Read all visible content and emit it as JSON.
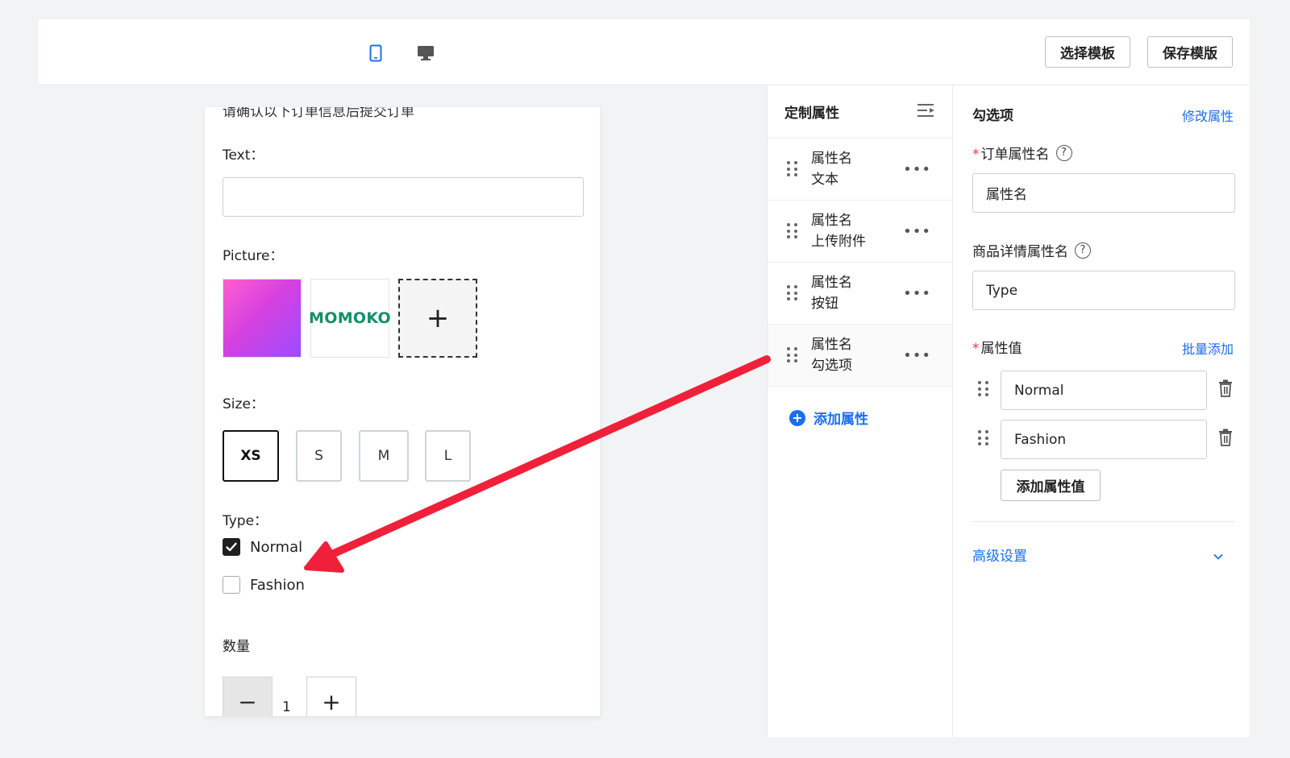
{
  "toolbar": {
    "device_icons": [
      "mobile-icon",
      "desktop-icon"
    ],
    "select_template_label": "选择模板",
    "save_template_label": "保存模版"
  },
  "preview": {
    "cut_text": "请确认以下订单信息后提交订单",
    "text_label": "Text：",
    "text_value": "",
    "picture_label": "Picture：",
    "logo_text": "MOMOKO",
    "add_picture_symbol": "+",
    "size_label": "Size：",
    "sizes": [
      "XS",
      "S",
      "M",
      "L"
    ],
    "selected_size": "XS",
    "type_label": "Type：",
    "type_options": [
      {
        "label": "Normal",
        "checked": true
      },
      {
        "label": "Fashion",
        "checked": false
      }
    ],
    "quantity_label": "数量",
    "quantity": {
      "minus": "−",
      "value": "1",
      "plus": "+"
    }
  },
  "attributes_panel": {
    "title": "定制属性",
    "items": [
      {
        "name": "属性名",
        "type": "文本"
      },
      {
        "name": "属性名",
        "type": "上传附件"
      },
      {
        "name": "属性名",
        "type": "按钮"
      },
      {
        "name": "属性名",
        "type": "勾选项"
      }
    ],
    "more_symbol": "•••",
    "add_label": "添加属性",
    "add_symbol": "+"
  },
  "property_panel": {
    "title": "勾选项",
    "modify_link": "修改属性",
    "required_mark": "*",
    "order_attr_label": "订单属性名",
    "order_attr_value": "属性名",
    "detail_attr_label": "商品详情属性名",
    "detail_attr_value": "Type",
    "help_symbol": "?",
    "values_label": "属性值",
    "batch_add_link": "批量添加",
    "values": [
      "Normal",
      "Fashion"
    ],
    "add_value_label": "添加属性值",
    "advanced_label": "高级设置"
  },
  "colors": {
    "accent": "#1a6ef0",
    "required": "#e53935",
    "annotation_arrow": "#f0203a"
  }
}
